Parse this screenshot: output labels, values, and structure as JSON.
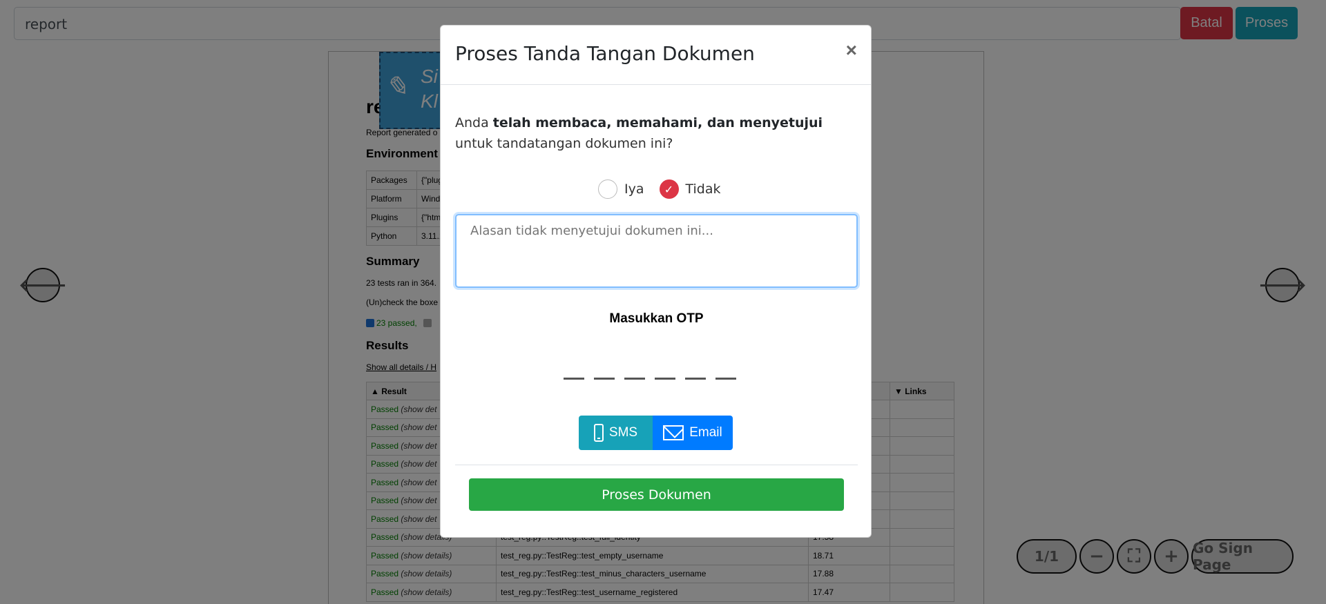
{
  "topbar": {
    "file_value": "report",
    "cancel_label": "Batal",
    "process_label": "Proses"
  },
  "document": {
    "title": "report",
    "subtitle": "Report generated o",
    "signature_text_1": "Si",
    "signature_text_2": "Kl",
    "environment_heading": "Environment",
    "environment": [
      {
        "key": "Packages",
        "value": "{\"plugi"
      },
      {
        "key": "Platform",
        "value": "Windo"
      },
      {
        "key": "Plugins",
        "value": "{\"html\""
      },
      {
        "key": "Python",
        "value": "3.11.1"
      }
    ],
    "summary_heading": "Summary",
    "summary_line1": "23 tests ran in 364.",
    "summary_line2": "(Un)check the boxe",
    "summary_passed": "23 passed,",
    "results_heading": "Results",
    "show_all": "Show all details / H",
    "columns": [
      "Result",
      "",
      "",
      "Links"
    ],
    "rows": [
      {
        "result": "Passed",
        "details": "(show det",
        "test": "",
        "duration": ""
      },
      {
        "result": "Passed",
        "details": "(show det",
        "test": "",
        "duration": ""
      },
      {
        "result": "Passed",
        "details": "(show det",
        "test": "",
        "duration": ""
      },
      {
        "result": "Passed",
        "details": "(show det",
        "test": "",
        "duration": ""
      },
      {
        "result": "Passed",
        "details": "(show det",
        "test": "",
        "duration": ""
      },
      {
        "result": "Passed",
        "details": "(show det",
        "test": "",
        "duration": ""
      },
      {
        "result": "Passed",
        "details": "(show det",
        "test": "",
        "duration": ""
      },
      {
        "result": "Passed",
        "details": "(show details)",
        "test": "test_reg.py::TestReg::test_full_identity",
        "duration": "17.58"
      },
      {
        "result": "Passed",
        "details": "(show details)",
        "test": "test_reg.py::TestReg::test_empty_username",
        "duration": "18.71"
      },
      {
        "result": "Passed",
        "details": "(show details)",
        "test": "test_reg.py::TestReg::test_minus_characters_username",
        "duration": "17.88"
      },
      {
        "result": "Passed",
        "details": "(show details)",
        "test": "test_reg.py::TestReg::test_username_registered",
        "duration": "17.47"
      }
    ]
  },
  "viewer": {
    "prev_icon": "arrow-left-icon",
    "next_icon": "arrow-right-icon",
    "page_indicator": "1/1",
    "zoom_out": "−",
    "fit": "⛶",
    "zoom_in": "+",
    "go_sign_page": "Go Sign Page"
  },
  "modal": {
    "title": "Proses Tanda Tangan Dokumen",
    "close": "×",
    "question_prefix": "Anda ",
    "question_bold": "telah membaca, memahami, dan menyetujui",
    "question_suffix": " untuk tandatangan dokumen ini?",
    "option_yes": "Iya",
    "option_no": "Tidak",
    "selected_option": "Tidak",
    "reason_placeholder": "Alasan tidak menyetujui dokumen ini...",
    "reason_value": "",
    "otp_title": "Masukkan OTP",
    "otp_length": 6,
    "sms_label": "SMS",
    "email_label": "Email",
    "submit_label": "Proses Dokumen"
  },
  "colors": {
    "danger": "#dc3545",
    "info": "#17a2b8",
    "primary": "#007bff",
    "success": "#28a745"
  }
}
